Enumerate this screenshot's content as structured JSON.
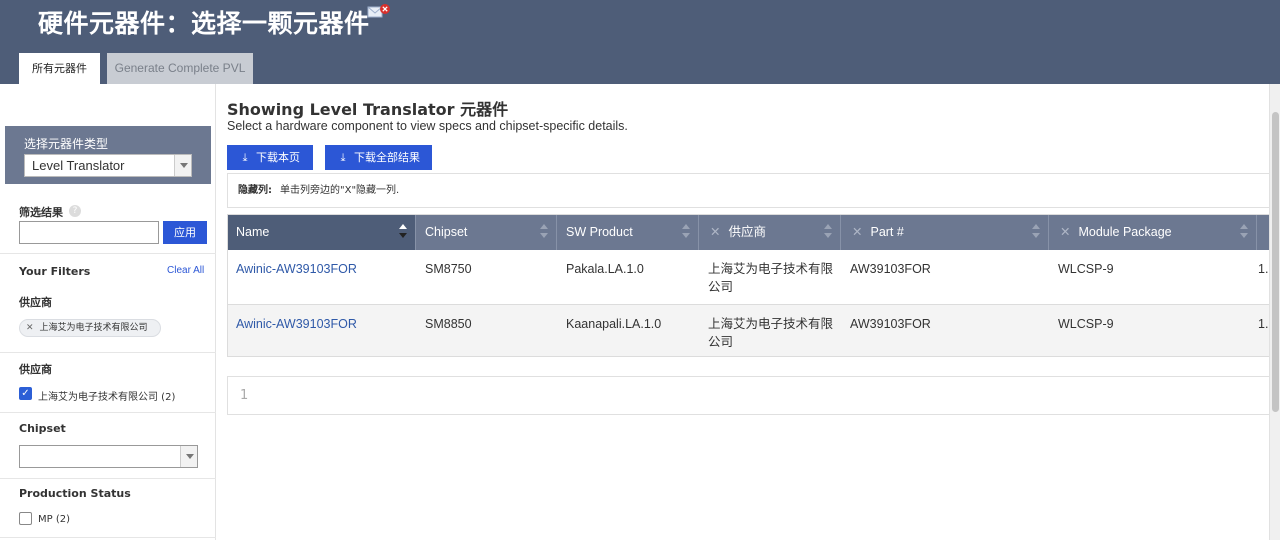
{
  "header": {
    "title": "硬件元器件：选择一颗元器件",
    "tabs": [
      {
        "label": "所有元器件",
        "active": true
      },
      {
        "label": "Generate Complete PVL",
        "active": false
      }
    ]
  },
  "sidebar": {
    "type_box_label": "选择元器件类型",
    "type_select_value": "Level Translator",
    "filter_results_label": "筛选结果",
    "filter_input_value": "",
    "apply_label": "应用",
    "your_filters_label": "Your Filters",
    "clear_all_label": "Clear All",
    "active_filter_group": "供应商",
    "active_filter_chip": "上海艾为电子技术有限公司",
    "vendor_group_label": "供应商",
    "vendor_option": "上海艾为电子技术有限公司 (2)",
    "vendor_checked": true,
    "chipset_label": "Chipset",
    "chipset_value": "",
    "production_status_label": "Production Status",
    "production_option": "MP (2)",
    "production_checked": false
  },
  "main": {
    "title": "Showing Level Translator 元器件",
    "subtitle": "Select a hardware component to view specs and chipset-specific details.",
    "download_page_label": "下载本页",
    "download_all_label": "下载全部结果",
    "hidden_columns_label": "隐藏列:",
    "hidden_columns_hint": "单击列旁边的\"X\"隐藏一列."
  },
  "table": {
    "columns": [
      "Name",
      "Chipset",
      "SW Product",
      "供应商",
      "Part #",
      "Module Package"
    ],
    "rows": [
      {
        "name": "Awinic-AW39103FOR",
        "chipset": "SM8750",
        "sw_product": "Pakala.LA.1.0",
        "vendor_line1": "上海艾为电子技术有限",
        "vendor_line2": "公司",
        "part": "AW39103FOR",
        "package": "WLCSP-9",
        "extra": "1."
      },
      {
        "name": "Awinic-AW39103FOR",
        "chipset": "SM8850",
        "sw_product": "Kaanapali.LA.1.0",
        "vendor_line1": "上海艾为电子技术有限",
        "vendor_line2": "公司",
        "part": "AW39103FOR",
        "package": "WLCSP-9",
        "extra": "1."
      }
    ]
  },
  "pagination": {
    "current_page": "1"
  },
  "colors": {
    "header_bg": "#4e5d78",
    "accent_blue": "#2c57d6",
    "table_header": "#6c7891",
    "link": "#2f59a8"
  },
  "icons": [
    "mail-error-icon",
    "help-icon",
    "download-icon",
    "chevron-down-icon",
    "close-icon",
    "sort-icon",
    "checkmark-icon"
  ]
}
